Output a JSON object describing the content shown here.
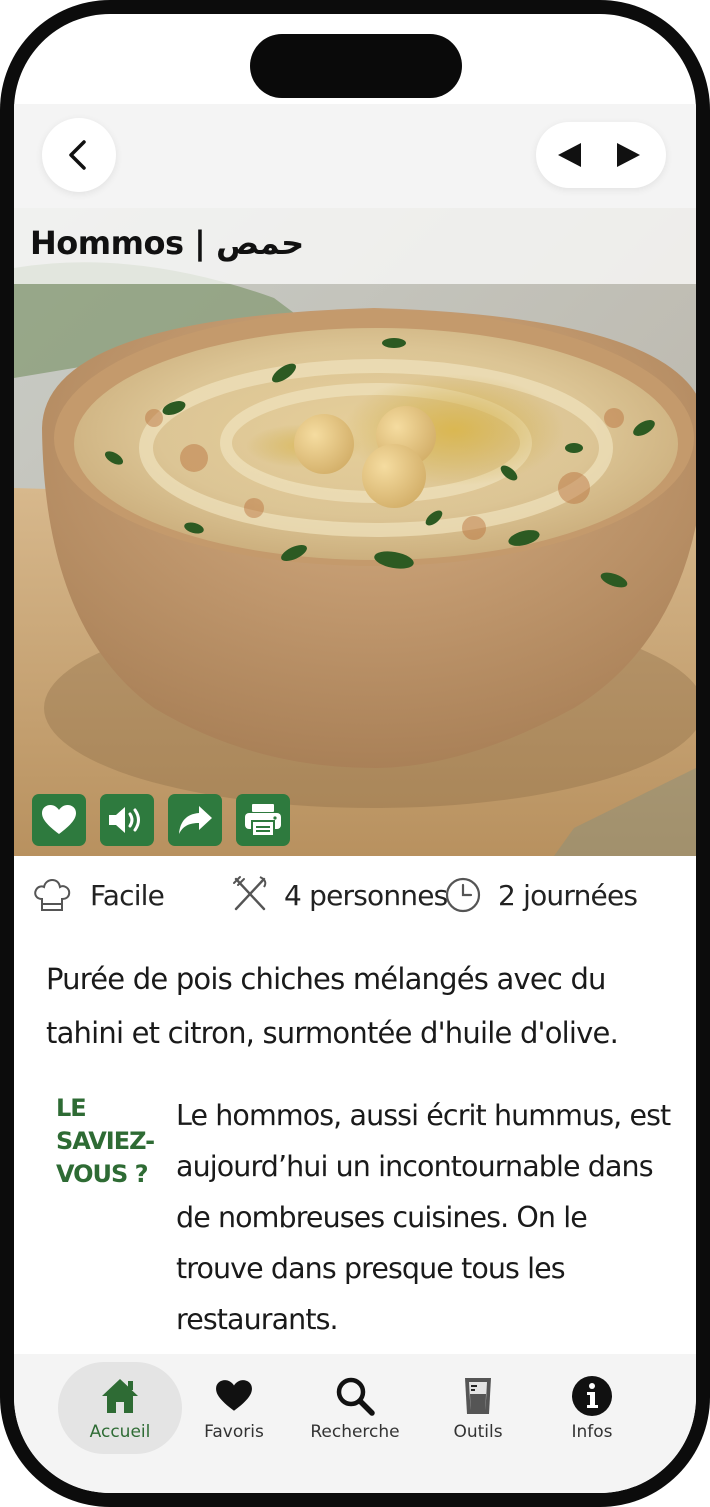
{
  "header": {
    "back_icon": "chevron-left-icon",
    "prev_icon": "triangle-left-icon",
    "next_icon": "triangle-right-icon"
  },
  "recipe": {
    "title": "Hommos | حمص",
    "image_subject": "hummus-bowl",
    "actions": [
      {
        "name": "favorite-button",
        "icon": "heart-icon"
      },
      {
        "name": "audio-button",
        "icon": "speaker-icon"
      },
      {
        "name": "share-button",
        "icon": "share-arrow-icon"
      },
      {
        "name": "print-button",
        "icon": "printer-icon"
      }
    ],
    "difficulty": "Facile",
    "servings": "4 personnes",
    "duration": "2 journées",
    "description": "Purée de pois chiches mélangés avec du tahini et citron, surmontée d'huile d'olive.",
    "did_you_know_label": "LE SAVIEZ-VOUS ?",
    "fact": "Le hommos, aussi écrit hummus, est aujourd’hui un incontournable dans de nombreuses cuisines. On le trouve dans presque tous les restaurants."
  },
  "tabs": [
    {
      "label": "Accueil",
      "icon": "home-icon",
      "active": true
    },
    {
      "label": "Favoris",
      "icon": "heart-icon",
      "active": false
    },
    {
      "label": "Recherche",
      "icon": "search-icon",
      "active": false
    },
    {
      "label": "Outils",
      "icon": "measuring-cup-icon",
      "active": false
    },
    {
      "label": "Infos",
      "icon": "info-icon",
      "active": false
    }
  ],
  "colors": {
    "accent": "#2e7a3e",
    "label_green": "#2e6b34",
    "bar_background": "#f4f4f4"
  }
}
